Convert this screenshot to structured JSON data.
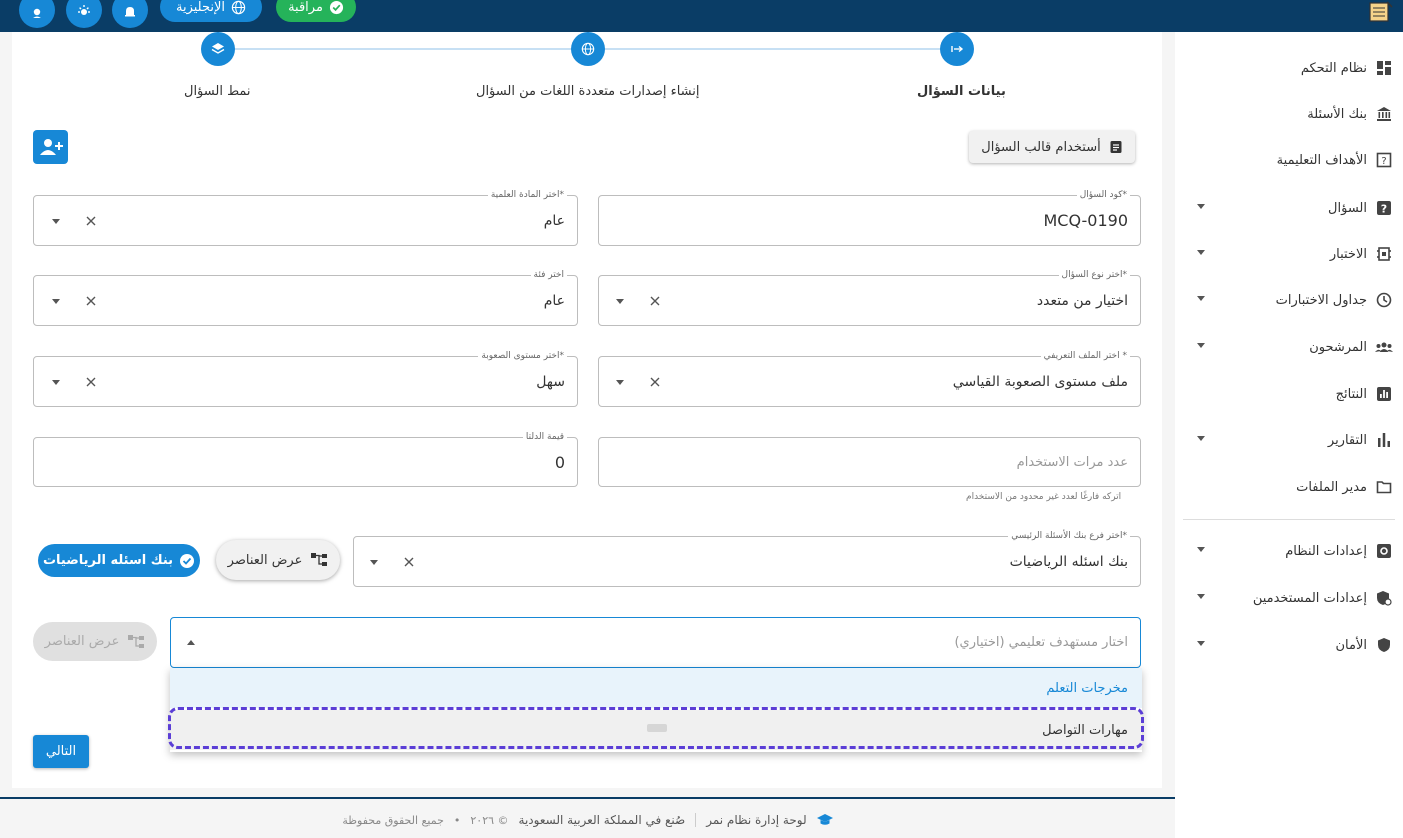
{
  "topbar": {
    "language_label": "الإنجليزية",
    "review_label": "مراقبة"
  },
  "sidebar": {
    "items": [
      {
        "label": "نظام التحكم",
        "icon": "dashboard-icon",
        "has_caret": false
      },
      {
        "label": "بنك الأسئلة",
        "icon": "bank-icon",
        "has_caret": false
      },
      {
        "label": "الأهداف التعليمية",
        "icon": "objectives-icon",
        "has_caret": false
      },
      {
        "label": "السؤال",
        "icon": "question-icon",
        "has_caret": true
      },
      {
        "label": "الاختبار",
        "icon": "exam-icon",
        "has_caret": true
      },
      {
        "label": "جداول الاختبارات",
        "icon": "clock-icon",
        "has_caret": true
      },
      {
        "label": "المرشحون",
        "icon": "people-icon",
        "has_caret": true
      },
      {
        "label": "النتائج",
        "icon": "results-icon",
        "has_caret": false
      },
      {
        "label": "التقارير",
        "icon": "bar-chart-icon",
        "has_caret": true
      },
      {
        "label": "مدير الملفات",
        "icon": "folder-icon",
        "has_caret": false
      },
      {
        "label": "إعدادات النظام",
        "icon": "settings-icon",
        "has_caret": true
      },
      {
        "label": "إعدادات المستخدمين",
        "icon": "user-settings-icon",
        "has_caret": true
      },
      {
        "label": "الأمان",
        "icon": "shield-icon",
        "has_caret": true
      }
    ]
  },
  "stepper": {
    "steps": [
      {
        "label": "بيانات السؤال",
        "icon": "arrow-right-icon",
        "active": true
      },
      {
        "label": "إنشاء إصدارات متعددة اللغات من السؤال",
        "icon": "globe-icon",
        "active": false
      },
      {
        "label": "نمط السؤال",
        "icon": "layers-icon",
        "active": false
      }
    ]
  },
  "toolbar": {
    "template_button": "أستخدام قالب السؤال"
  },
  "form": {
    "question_code": {
      "label": "كود السؤال*",
      "value": "MCQ-0190"
    },
    "subject": {
      "label": "اختر المادة العلمية*",
      "value": "عام"
    },
    "question_type": {
      "label": "اختر نوع السؤال*",
      "value": "اختيار من متعدد"
    },
    "category": {
      "label": "اختر فئة",
      "value": "عام"
    },
    "profile": {
      "label": "اختر الملف التعريفي *",
      "value": "ملف مستوى الصعوبة القياسي"
    },
    "difficulty": {
      "label": "اختر مستوى الصعوبة*",
      "value": "سهل"
    },
    "usage_count": {
      "placeholder": "عدد مرات الاستخدام",
      "helper": "اتركه فارغًا لعدد غير محدود من الاستخدام"
    },
    "delta": {
      "label": "قيمة الدلتا",
      "value": "0"
    },
    "bank_branch": {
      "label": "اختر فرع بنك الأسئلة الرئيسي*",
      "value": "بنك اسئله الرياضيات"
    },
    "show_elements": "عرض العناصر",
    "bank_chip": "بنك اسئله الرياضيات",
    "objective": {
      "placeholder": "اختار مستهدف تعليمي (اختياري)"
    },
    "show_elements_disabled": "عرض العناصر"
  },
  "dropdown": {
    "options": [
      {
        "label": "مخرجات التعلم",
        "selected": true
      },
      {
        "label": "مهارات التواصل",
        "selected": false
      }
    ]
  },
  "next_button": "التالي",
  "footer": {
    "brand": "لوحة إدارة نظام نمر",
    "made_in": "صُنع في المملكة العربية السعودية",
    "copyright": "© ٢٠٢٦",
    "rights": "جميع الحقوق محفوظة"
  },
  "colors": {
    "primary": "#1788d6",
    "header": "#0a3d66",
    "success": "#25b35a",
    "focus_outline": "#5b3ed6"
  }
}
